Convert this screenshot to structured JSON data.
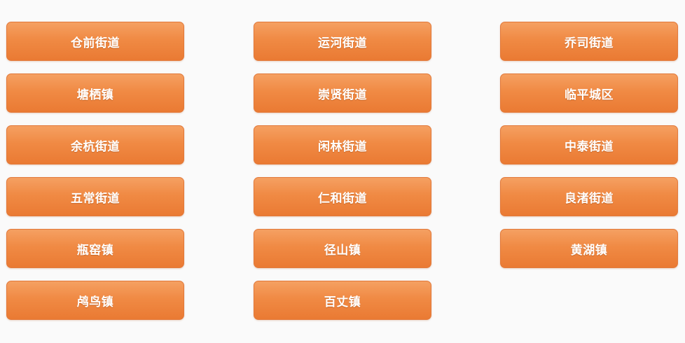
{
  "columns": [
    {
      "items": [
        {
          "label": "仓前街道"
        },
        {
          "label": "塘栖镇"
        },
        {
          "label": "余杭街道"
        },
        {
          "label": "五常街道"
        },
        {
          "label": "瓶窑镇"
        },
        {
          "label": "鸬鸟镇"
        }
      ]
    },
    {
      "items": [
        {
          "label": "运河街道"
        },
        {
          "label": "崇贤街道"
        },
        {
          "label": "闲林街道"
        },
        {
          "label": "仁和街道"
        },
        {
          "label": "径山镇"
        },
        {
          "label": "百丈镇"
        }
      ]
    },
    {
      "items": [
        {
          "label": "乔司街道"
        },
        {
          "label": "临平城区"
        },
        {
          "label": "中泰街道"
        },
        {
          "label": "良渚街道"
        },
        {
          "label": "黄湖镇"
        }
      ]
    }
  ],
  "colors": {
    "button_top": "#f5a062",
    "button_bottom": "#ea7a33",
    "button_text": "#ffffff",
    "background": "#fafafa"
  }
}
